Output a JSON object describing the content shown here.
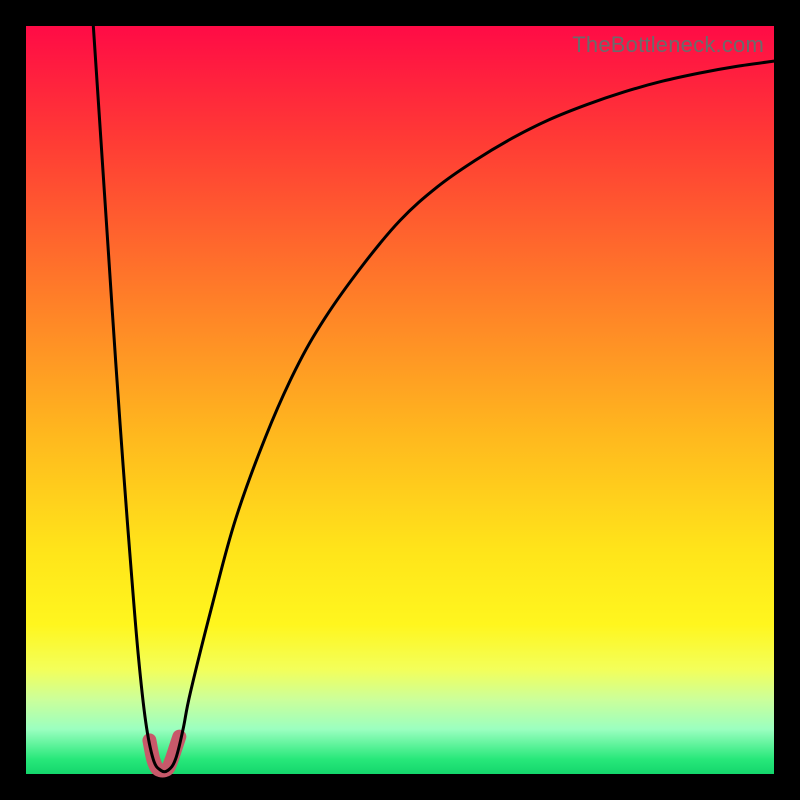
{
  "watermark": "TheBottleneck.com",
  "chart_data": {
    "type": "line",
    "title": "",
    "xlabel": "",
    "ylabel": "",
    "xlim": [
      0,
      100
    ],
    "ylim": [
      0,
      100
    ],
    "grid": false,
    "legend": false,
    "series": [
      {
        "name": "curve",
        "x": [
          9,
          10,
          11,
          12,
          13,
          14,
          15,
          16,
          17,
          18,
          19,
          20,
          21,
          22,
          25,
          28,
          32,
          36,
          40,
          45,
          50,
          55,
          60,
          65,
          70,
          75,
          80,
          85,
          90,
          95,
          100
        ],
        "y": [
          100,
          85,
          70,
          55,
          41,
          28,
          16,
          7,
          2,
          0.5,
          0.5,
          2,
          6,
          11,
          23,
          34,
          45,
          54,
          61,
          68,
          74,
          78.5,
          82,
          85,
          87.5,
          89.5,
          91.2,
          92.6,
          93.7,
          94.6,
          95.3
        ]
      },
      {
        "name": "highlight",
        "x": [
          16.5,
          17,
          17.5,
          18,
          18.5,
          19,
          19.5,
          20,
          20.5
        ],
        "y": [
          4.5,
          2,
          0.8,
          0.5,
          0.5,
          0.8,
          2,
          3.5,
          5
        ]
      }
    ],
    "annotations": []
  },
  "colors": {
    "frame": "#000000",
    "curve": "#000000",
    "highlight": "#c8596a",
    "gradient_top": "#ff0b46",
    "gradient_bottom": "#14d66c"
  }
}
